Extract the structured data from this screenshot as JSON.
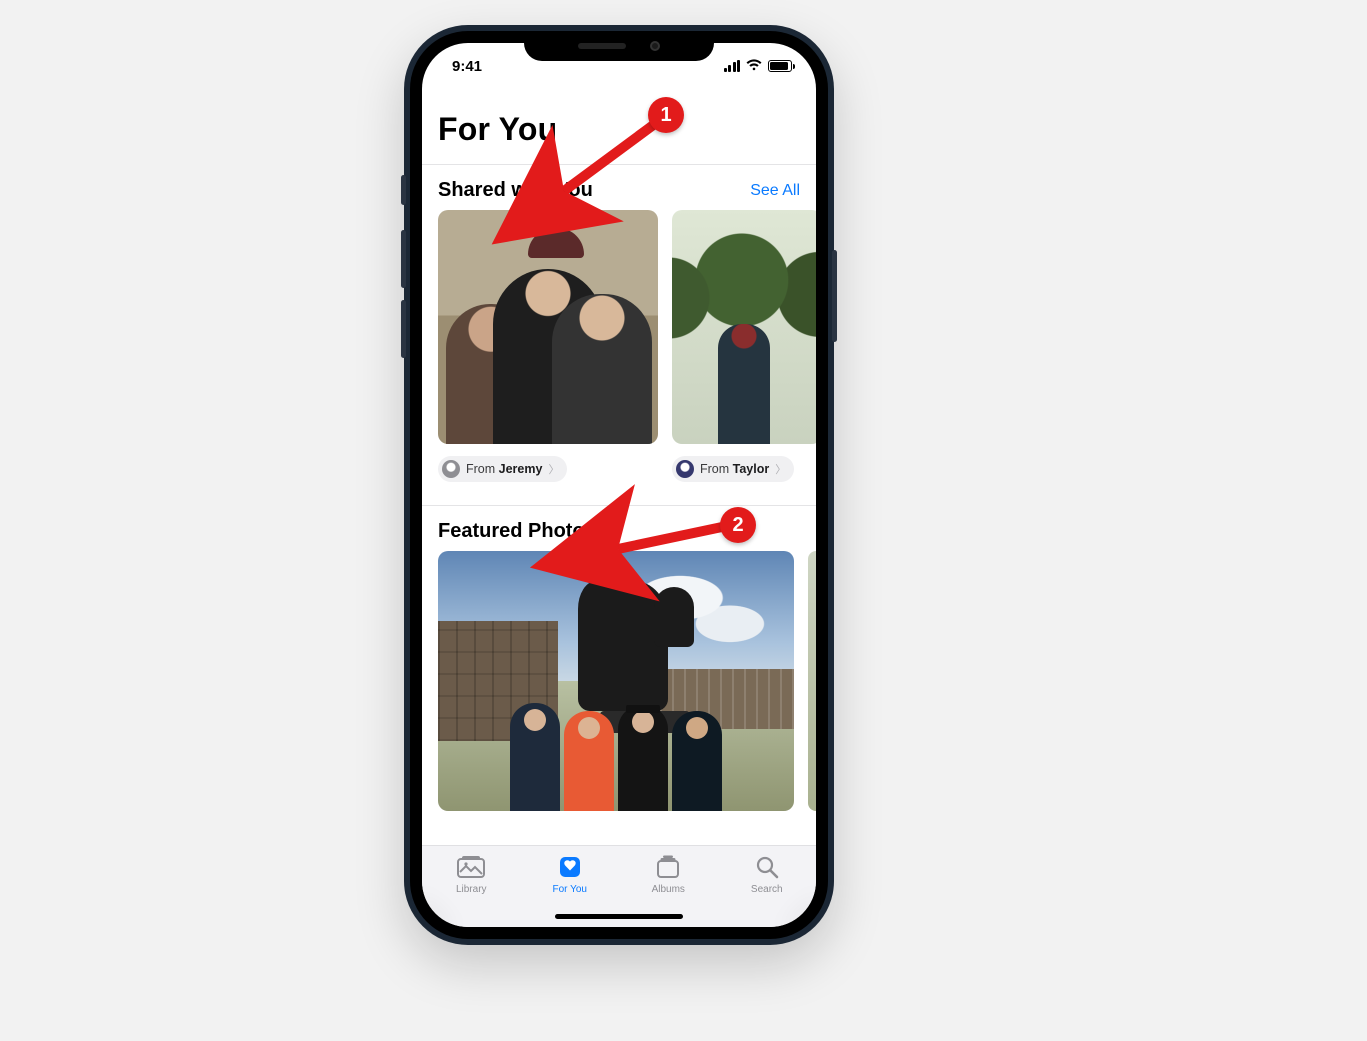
{
  "status": {
    "time": "9:41"
  },
  "page": {
    "title": "For You"
  },
  "shared": {
    "title": "Shared with You",
    "see_all": "See All",
    "items": [
      {
        "from_prefix": "From ",
        "from_name": "Jeremy"
      },
      {
        "from_prefix": "From ",
        "from_name": "Taylor"
      }
    ]
  },
  "featured": {
    "title": "Featured Photos"
  },
  "tabs": [
    {
      "label": "Library"
    },
    {
      "label": "For You"
    },
    {
      "label": "Albums"
    },
    {
      "label": "Search"
    }
  ],
  "annotations": [
    {
      "n": "1"
    },
    {
      "n": "2"
    }
  ]
}
